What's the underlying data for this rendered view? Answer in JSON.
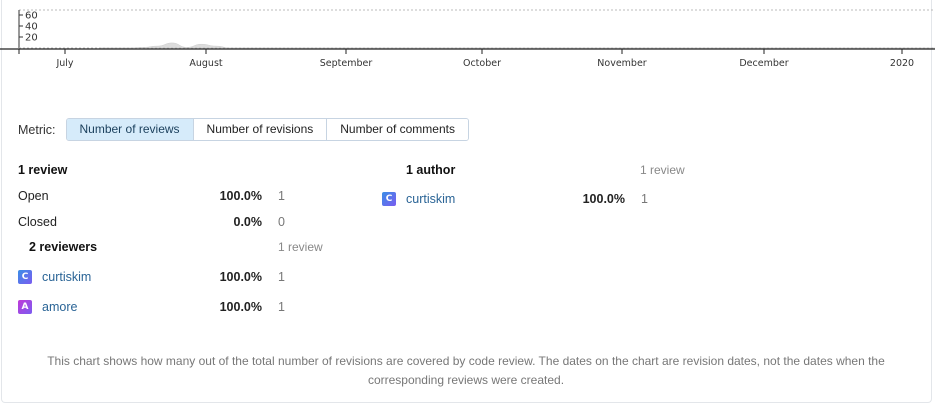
{
  "chart_data": {
    "type": "area",
    "x_tick_labels": [
      "July",
      "August",
      "September",
      "October",
      "November",
      "December",
      "2020"
    ],
    "y_tick_labels": [
      "60",
      "40",
      "20"
    ],
    "ylim": [
      0,
      60
    ],
    "grid": false,
    "series": [
      {
        "values": [
          0,
          0,
          0,
          1,
          3,
          8,
          1,
          6,
          3,
          0,
          0,
          0,
          0,
          0,
          0,
          0,
          0,
          0,
          0,
          0,
          0,
          0,
          0,
          0,
          0
        ]
      }
    ]
  },
  "metric": {
    "label": "Metric:",
    "options": [
      "Number of reviews",
      "Number of revisions",
      "Number of comments"
    ],
    "active_index": 0
  },
  "reviews": {
    "heading": "1 review",
    "rows": [
      {
        "label": "Open",
        "pct": "100.0%",
        "count": "1"
      },
      {
        "label": "Closed",
        "pct": "0.0%",
        "count": "0"
      }
    ]
  },
  "reviewers": {
    "heading": "2 reviewers",
    "subheading": "1 review",
    "rows": [
      {
        "avatar_letter": "C",
        "avatar_color": "#3a8ee6",
        "name": "curtiskim",
        "pct": "100.0%",
        "count": "1"
      },
      {
        "avatar_letter": "A",
        "avatar_color": "#c03ad8",
        "name": "amore",
        "pct": "100.0%",
        "count": "1"
      }
    ]
  },
  "authors": {
    "heading": "1 author",
    "subheading": "1 review",
    "rows": [
      {
        "avatar_letter": "C",
        "avatar_color": "#3a8ee6",
        "name": "curtiskim",
        "pct": "100.0%",
        "count": "1"
      }
    ]
  },
  "footer": {
    "note": "This chart shows how many out of the total number of revisions are covered by code review. The dates on the chart are revision dates, not the dates when the corresponding reviews were created."
  }
}
